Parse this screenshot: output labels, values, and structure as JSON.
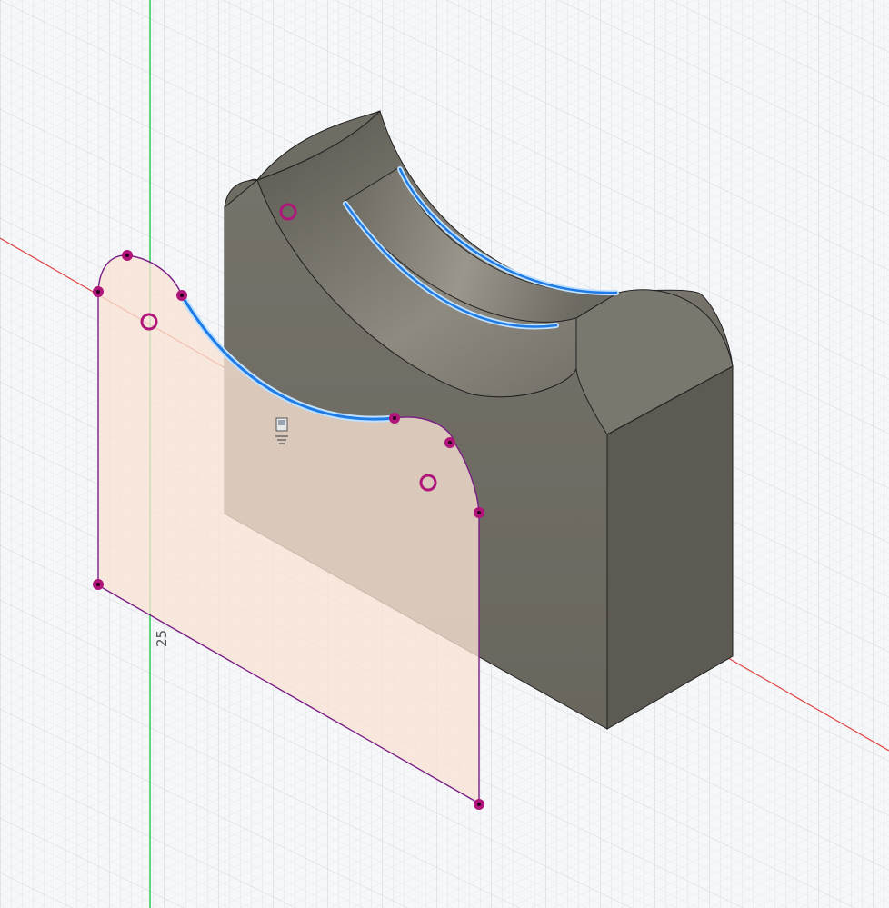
{
  "viewport": {
    "background": "#f6f7f9",
    "grid_color": "#cfd3d8",
    "grid_minor_color": "#e3e6ea"
  },
  "colors": {
    "x_axis": "#e04646",
    "y_axis": "#2ecc55",
    "sketch_line": "#7a1f86",
    "sketch_point": "#b0157a",
    "selected_curve": "#1e7be6",
    "selected_glow": "#bfe0ff",
    "profile_fill": "#f9e3d4",
    "body_front": "#6e6b63",
    "body_top": "#8a877e",
    "body_side": "#5b5851"
  },
  "sketch": {
    "dimension_text": "25"
  },
  "icons": {
    "origin": "sketch-origin-icon"
  }
}
